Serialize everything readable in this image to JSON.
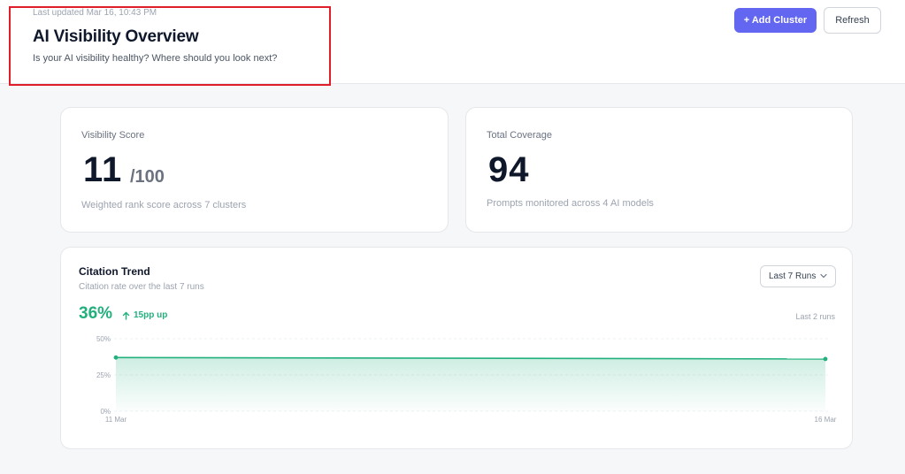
{
  "header": {
    "last_updated": "Last updated Mar 16, 10:43 PM",
    "title": "AI Visibility Overview",
    "subtitle": "Is your AI visibility healthy? Where should you look next?",
    "add_cluster_label": "+ Add Cluster",
    "refresh_label": "Refresh",
    "accent_color": "#6366f1",
    "highlight_color": "#e11d2a"
  },
  "visibility_score": {
    "label": "Visibility Score",
    "value": "11",
    "suffix": "/100",
    "footnote": "Weighted rank score across 7 clusters"
  },
  "total_coverage": {
    "label": "Total Coverage",
    "value": "94",
    "footnote": "Prompts monitored across 4 AI models"
  },
  "citation_trend": {
    "title": "Citation Trend",
    "subtitle": "Citation rate over the last 7 runs",
    "range_select": "Last 7 Runs",
    "current_rate": "36%",
    "delta": "15pp up",
    "delta_icon": "arrow-up-icon",
    "range_label": "Last 2 runs",
    "status_color": "#22b07d"
  },
  "chart_data": {
    "type": "area",
    "x": [
      "11 Mar",
      "16 Mar"
    ],
    "series": [
      {
        "values": [
          37,
          36
        ]
      }
    ],
    "ylim": [
      0,
      50
    ],
    "yticks": [
      "0%",
      "25%",
      "50%"
    ],
    "grid": true,
    "color": "#22b07d"
  }
}
